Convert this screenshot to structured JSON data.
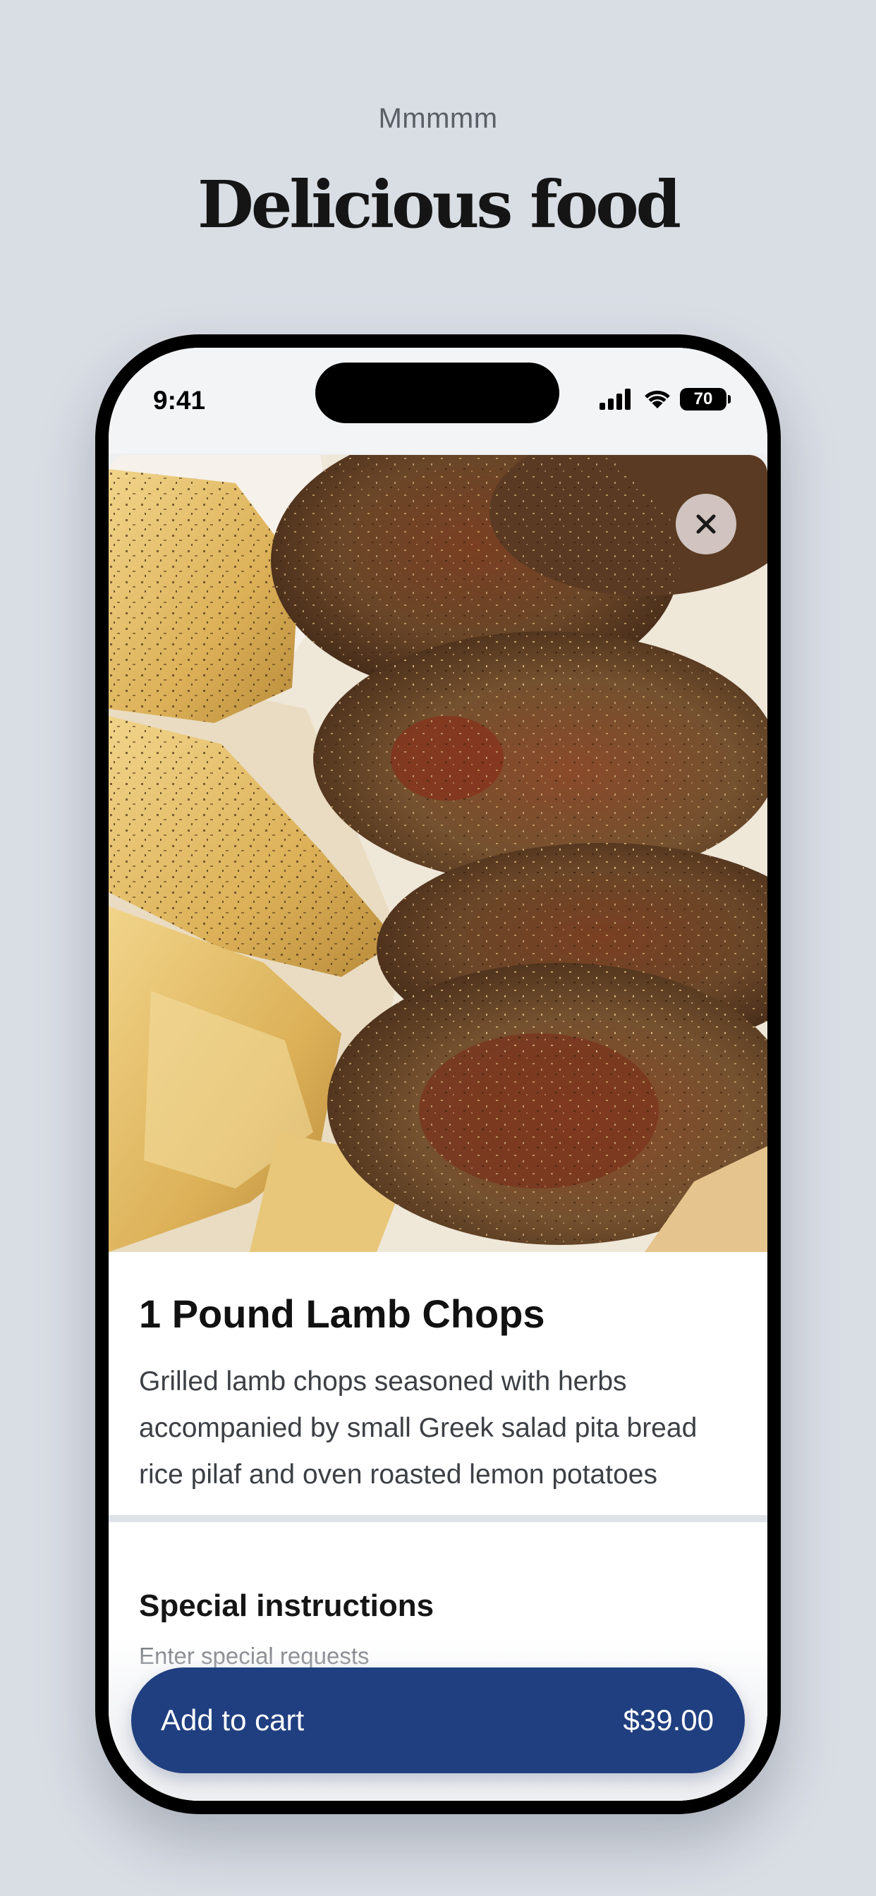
{
  "page": {
    "eyebrow": "Mmmmm",
    "headline": "Delicious food"
  },
  "status_bar": {
    "time": "9:41",
    "battery_level": "70"
  },
  "hero": {
    "image_alt": "Grilled lamb chops with roasted lemon potatoes",
    "close_icon": "close-icon"
  },
  "dish": {
    "title": "1 Pound Lamb Chops",
    "description": "Grilled lamb chops seasoned with herbs accompanied by small Greek salad pita bread rice pilaf and oven roasted lemon potatoes"
  },
  "special_instructions": {
    "title": "Special instructions",
    "placeholder": "Enter special requests"
  },
  "cart": {
    "label": "Add to cart",
    "price": "$39.00"
  },
  "colors": {
    "background": "#d9dde4",
    "button": "#203f80",
    "text": "#111111"
  }
}
